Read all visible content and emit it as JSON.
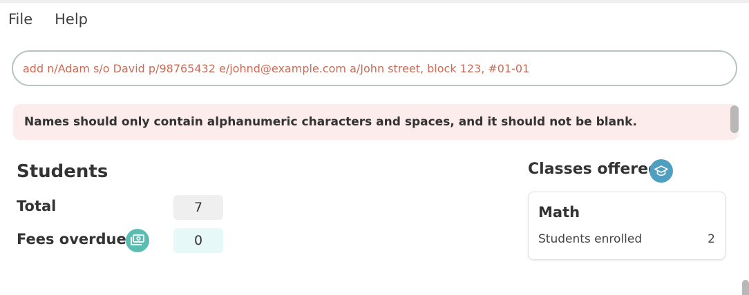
{
  "menu": {
    "file": "File",
    "help": "Help"
  },
  "command": {
    "value": "add n/Adam s/o David p/98765432 e/johnd@example.com a/John street, block 123, #01-01"
  },
  "result": {
    "message": "Names should only contain alphanumeric characters and spaces, and it should not be blank."
  },
  "students": {
    "title": "Students",
    "total_label": "Total",
    "total_value": "7",
    "fees_label": "Fees overdue",
    "fees_value": "0",
    "fees_icon": "money-icon"
  },
  "classes": {
    "title": "Classes offered",
    "icon": "graduation-cap-icon",
    "items": [
      {
        "name": "Math",
        "enrolled_label": "Students enrolled",
        "enrolled_value": "2"
      }
    ]
  },
  "colors": {
    "command_text": "#cc6a55",
    "result_background": "#fcecec",
    "money_icon": "#5bbdb1",
    "cap_icon": "#4f9fc1"
  }
}
